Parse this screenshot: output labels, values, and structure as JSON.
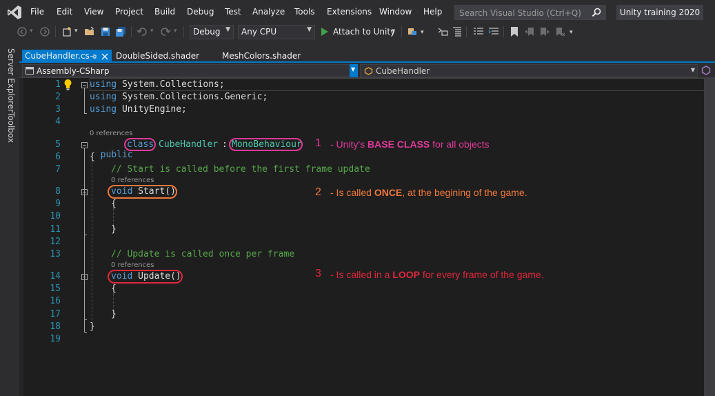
{
  "menu": {
    "items": [
      "File",
      "Edit",
      "View",
      "Project",
      "Build",
      "Debug",
      "Test",
      "Analyze",
      "Tools",
      "Extensions",
      "Window",
      "Help"
    ],
    "search_placeholder": "Search Visual Studio (Ctrl+Q)",
    "solution_name": "Unity training 2020"
  },
  "toolbar": {
    "config": "Debug",
    "platform": "Any CPU",
    "attach_label": "Attach to Unity"
  },
  "side_tabs": {
    "server_explorer": "Server Explorer",
    "toolbox": "Toolbox"
  },
  "tabs": [
    {
      "label": "CubeHandler.cs",
      "active": true
    },
    {
      "label": "DoubleSided.shader",
      "active": false
    },
    {
      "label": "MeshColors.shader",
      "active": false
    }
  ],
  "nav": {
    "project": "Assembly-CSharp",
    "class": "CubeHandler"
  },
  "code": {
    "line_numbers": [
      "1",
      "2",
      "3",
      "4",
      "5",
      "6",
      "7",
      "8",
      "9",
      "10",
      "11",
      "12",
      "13",
      "14",
      "15",
      "16",
      "17",
      "18",
      "19"
    ],
    "l1_kw": "using",
    "l1_rest": " System.Collections;",
    "l2_kw": "using",
    "l2_rest": " System.Collections.Generic;",
    "l3_kw": "using",
    "l3_rest": " UnityEngine;",
    "refs": "0 references",
    "l5_public": "public",
    "l5_class": "class",
    "l5_name": "CubeHandler",
    "l5_colon": ":",
    "l5_base": "MonoBehaviour",
    "brace_open": "{",
    "brace_close": "}",
    "l7_comment": "// Start is called before the first frame update",
    "l8_void": "void",
    "l8_name": "Start()",
    "l13_comment": "// Update is called once per frame",
    "l14_void": "void",
    "l14_name": "Update()"
  },
  "annotations": [
    {
      "num": "1",
      "prefix": "- Unity's ",
      "bold": "BASE CLASS",
      "suffix": " for all objects",
      "color": "#e0399a"
    },
    {
      "num": "2",
      "prefix": "- Is called ",
      "bold": "ONCE",
      "suffix": ", at the begining of the game.",
      "color": "#f0783c"
    },
    {
      "num": "3",
      "prefix": "- Is called in a ",
      "bold": "LOOP",
      "suffix": " for every frame of the game.",
      "color": "#e0283c"
    }
  ],
  "colors": {
    "accent": "#007acc",
    "keyword": "#569cd6",
    "type": "#4ec9b0",
    "comment": "#57a64a",
    "line_number": "#2b91af"
  }
}
